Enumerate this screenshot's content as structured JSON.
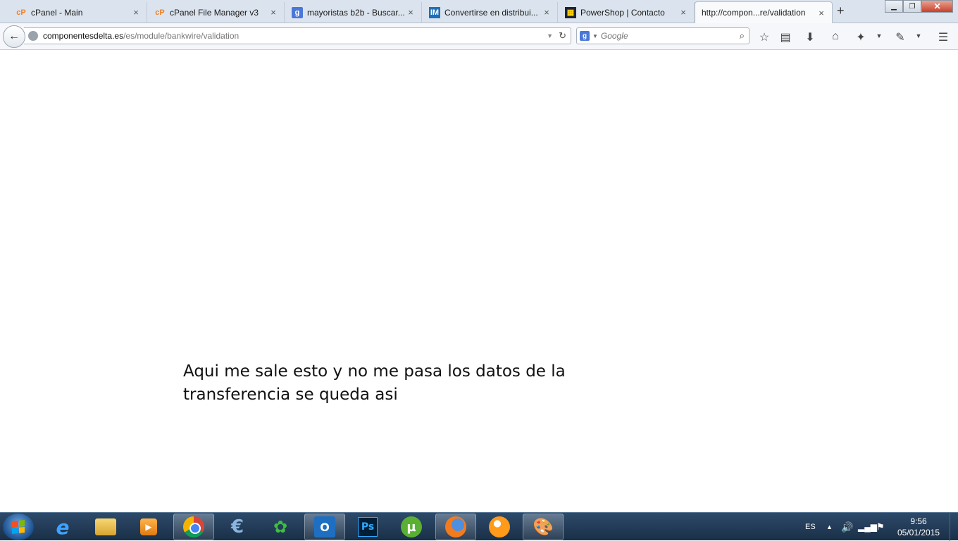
{
  "tabs": [
    {
      "label": "cPanel - Main",
      "favicon": "cp"
    },
    {
      "label": "cPanel File Manager v3",
      "favicon": "cp"
    },
    {
      "label": "mayoristas b2b - Buscar...",
      "favicon": "g"
    },
    {
      "label": "Convertirse en distribui...",
      "favicon": "IM"
    },
    {
      "label": "PowerShop | Contacto",
      "favicon": "ps"
    },
    {
      "label": "http://compon...re/validation",
      "favicon": "",
      "active": true
    }
  ],
  "icons": {
    "close": "×",
    "new_tab": "+",
    "back": "←",
    "reload": "↻",
    "dropdown": "▼",
    "search": "⌕",
    "minimize": "▁",
    "maximize": "❐",
    "window_close": "✕"
  },
  "address_bar": {
    "host": "componentesdelta.es",
    "path": "/es/module/bankwire/validation"
  },
  "search_bar": {
    "engine_letter": "g",
    "placeholder": "Google"
  },
  "toolbar_icons": [
    "star-icon",
    "reading-list-icon",
    "download-icon",
    "home-icon",
    "addon-icon",
    "tools-icon",
    "menu-icon"
  ],
  "page": {
    "message": "Aqui me sale esto y no me pasa los datos de la transferencia se queda asi"
  },
  "taskbar": {
    "apps": [
      "internet-explorer",
      "file-explorer",
      "media-player",
      "chrome",
      "app-e",
      "app-green",
      "outlook",
      "photoshop",
      "utorrent",
      "firefox",
      "bubble-app",
      "paint-app"
    ],
    "language": "ES",
    "time": "9:56",
    "date": "05/01/2015"
  },
  "colors": {
    "tabstrip_bg": "#dbe4ee",
    "taskbar_bg": "#1a2f47",
    "page_bg": "#ffffff"
  }
}
